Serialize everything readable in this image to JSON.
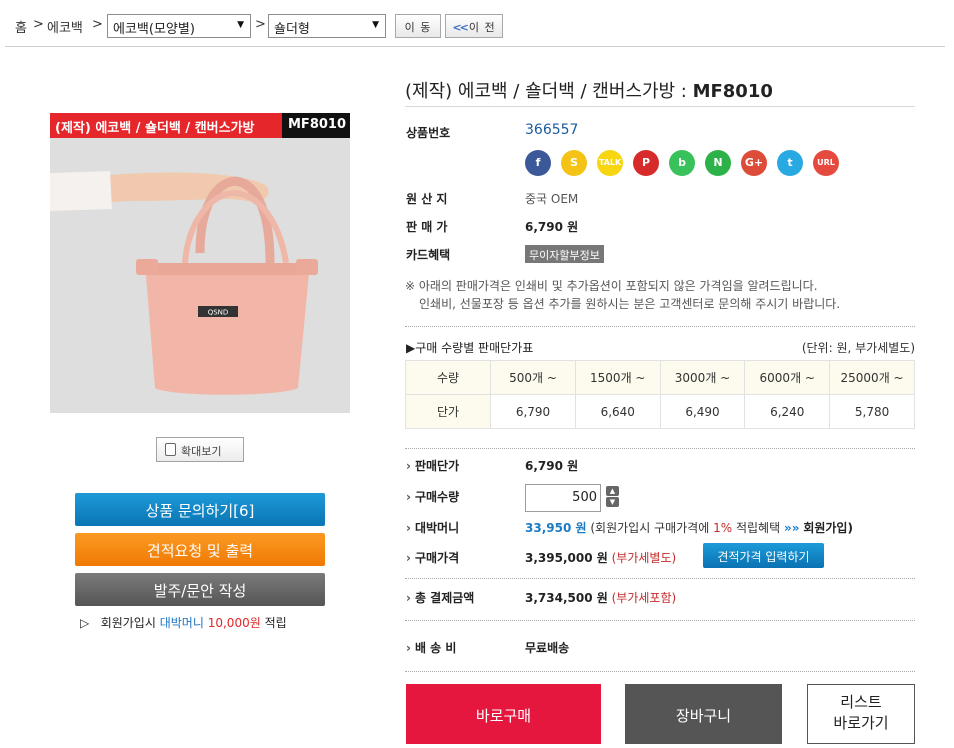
{
  "breadcrumb": {
    "home": "홈",
    "sep1": ">",
    "level1": "에코백",
    "sep2": ">",
    "select1": "에코백(모양별)",
    "sep3": ">",
    "select2": "숄더형",
    "move_label": "이 동",
    "prev_label": "이 전",
    "prev_arrows": "<<"
  },
  "product": {
    "title_prefix": "(제작) 에코백 / 숄더백 / 캔버스가방 : ",
    "title_code": "MF8010",
    "image_banner": "(제작) 에코백 / 숄더백 / 캔버스가방",
    "image_code": "MF8010",
    "zoom_label": "확대보기"
  },
  "left_buttons": {
    "inquiry": "상품 문의하기[6]",
    "quote": "견적요청 및 출력",
    "order": "발주/문안 작성"
  },
  "signup_note": {
    "arrow": "▷",
    "text1": "회원가입시",
    "money_label": "대박머니",
    "amount": "10,000원",
    "text2": "적립"
  },
  "info": {
    "prodno_label": "상품번호",
    "prodno_value": "366557",
    "origin_label": "원 산 지",
    "origin_value": "중국 OEM",
    "price_label": "판 매 가",
    "price_value": "6,790 원",
    "card_label": "카드혜택",
    "card_badge": "무이자할부정보"
  },
  "share_icons": [
    {
      "name": "facebook-icon",
      "glyph": "f",
      "color": "#3b5998"
    },
    {
      "name": "kakaostory-icon",
      "glyph": "S",
      "color": "#f5c316"
    },
    {
      "name": "kakaotalk-icon",
      "glyph": "TALK",
      "color": "#f7d511"
    },
    {
      "name": "pinterest-icon",
      "glyph": "P",
      "color": "#d72b2b"
    },
    {
      "name": "band-icon",
      "glyph": "b",
      "color": "#39c25b"
    },
    {
      "name": "naver-icon",
      "glyph": "N",
      "color": "#2db24a"
    },
    {
      "name": "googleplus-icon",
      "glyph": "G+",
      "color": "#dd4b39"
    },
    {
      "name": "twitter-icon",
      "glyph": "t",
      "color": "#29a9e1"
    },
    {
      "name": "url-icon",
      "glyph": "URL",
      "color": "#e44a3e"
    }
  ],
  "notice": {
    "line1": "※ 아래의 판매가격은 인쇄비 및 추가옵션이 포함되지 않은 가격임을 알려드립니다.",
    "line2": "인쇄비, 선물포장 등 옵션 추가를 원하시는 분은 고객센터로 문의해 주시기 바랍니다."
  },
  "qty_table": {
    "heading": "▶구매 수량별 판매단가표",
    "unit_note": "(단위: 원, 부가세별도)",
    "row1_label": "수량",
    "quantities": [
      "500개 ~",
      "1500개 ~",
      "3000개 ~",
      "6000개 ~",
      "25000개 ~"
    ],
    "row2_label": "단가",
    "prices": [
      "6,790",
      "6,640",
      "6,490",
      "6,240",
      "5,780"
    ]
  },
  "order": {
    "unit_price_label": "판매단가",
    "unit_price_value": "6,790 원",
    "qty_label": "구매수량",
    "qty_value": "500",
    "money_label": "대박머니",
    "money_value": "33,950 원",
    "money_note1": "(회원가입시 구매가격에",
    "money_percent": "1%",
    "money_note2": "적립혜택",
    "money_arrows": "»»",
    "money_signup": "회원가입)",
    "buy_price_label": "구매가격",
    "buy_price_value": "3,395,000 원",
    "buy_price_note": "(부가세별도)",
    "estimate_button": "견적가격 입력하기",
    "total_label": "총 결제금액",
    "total_value": "3,734,500 원",
    "total_note": "(부가세포함)",
    "shipping_label": "배 송 비",
    "shipping_value": "무료배송"
  },
  "actions": {
    "buy_now": "바로구매",
    "cart": "장바구니",
    "list_line1": "리스트",
    "list_line2": "바로가기"
  }
}
